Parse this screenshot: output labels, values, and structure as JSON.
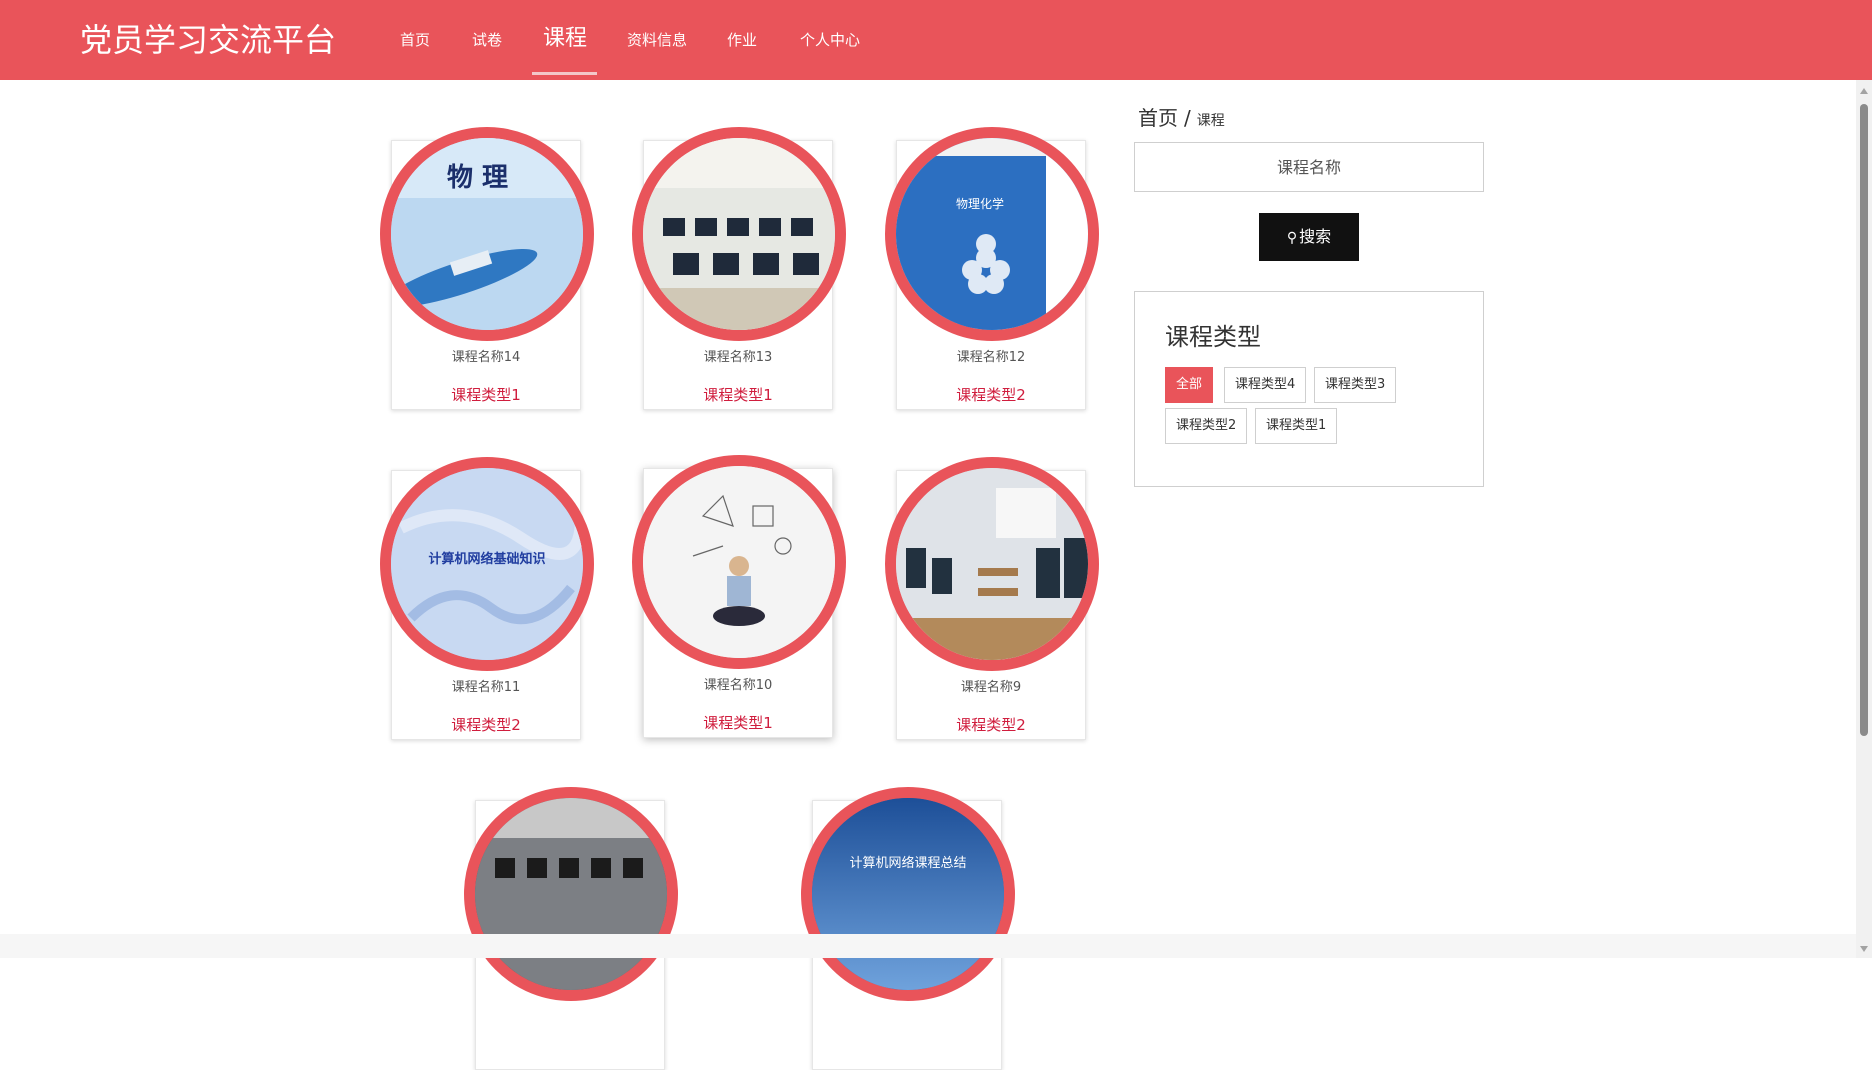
{
  "header": {
    "brand": "党员学习交流平台",
    "nav": [
      "首页",
      "试卷",
      "课程",
      "资料信息",
      "作业",
      "个人中心"
    ],
    "active_nav": "课程"
  },
  "breadcrumb": {
    "home": "首页",
    "separator": "/",
    "current": "课程"
  },
  "search": {
    "placeholder": "课程名称",
    "button_label": "搜索",
    "icon": "search-icon"
  },
  "course_types": {
    "heading": "课程类型",
    "tags": [
      "全部",
      "课程类型4",
      "课程类型3",
      "课程类型2",
      "课程类型1"
    ],
    "selected": "全部"
  },
  "courses": [
    {
      "name": "课程名称14",
      "type": "课程类型1",
      "image": "physics-textbook-cover"
    },
    {
      "name": "课程名称13",
      "type": "课程类型1",
      "image": "computer-lab-photo"
    },
    {
      "name": "课程名称12",
      "type": "课程类型2",
      "image": "chemistry-textbook-cover"
    },
    {
      "name": "课程名称11",
      "type": "课程类型2",
      "image": "network-basics-cover",
      "image_text": "计算机网络基础知识"
    },
    {
      "name": "课程名称10",
      "type": "课程类型1",
      "image": "student-reading-illustration"
    },
    {
      "name": "课程名称9",
      "type": "课程类型2",
      "image": "classroom-computers-photo"
    },
    {
      "name": "",
      "type": "",
      "image": "computer-lab-students-photo"
    },
    {
      "name": "",
      "type": "",
      "image": "network-course-summary-cover",
      "image_text": "计算机网络课程总结"
    }
  ],
  "colors": {
    "brand_red": "#e9545a",
    "type_text": "#d01d3d",
    "search_button": "#111111"
  }
}
